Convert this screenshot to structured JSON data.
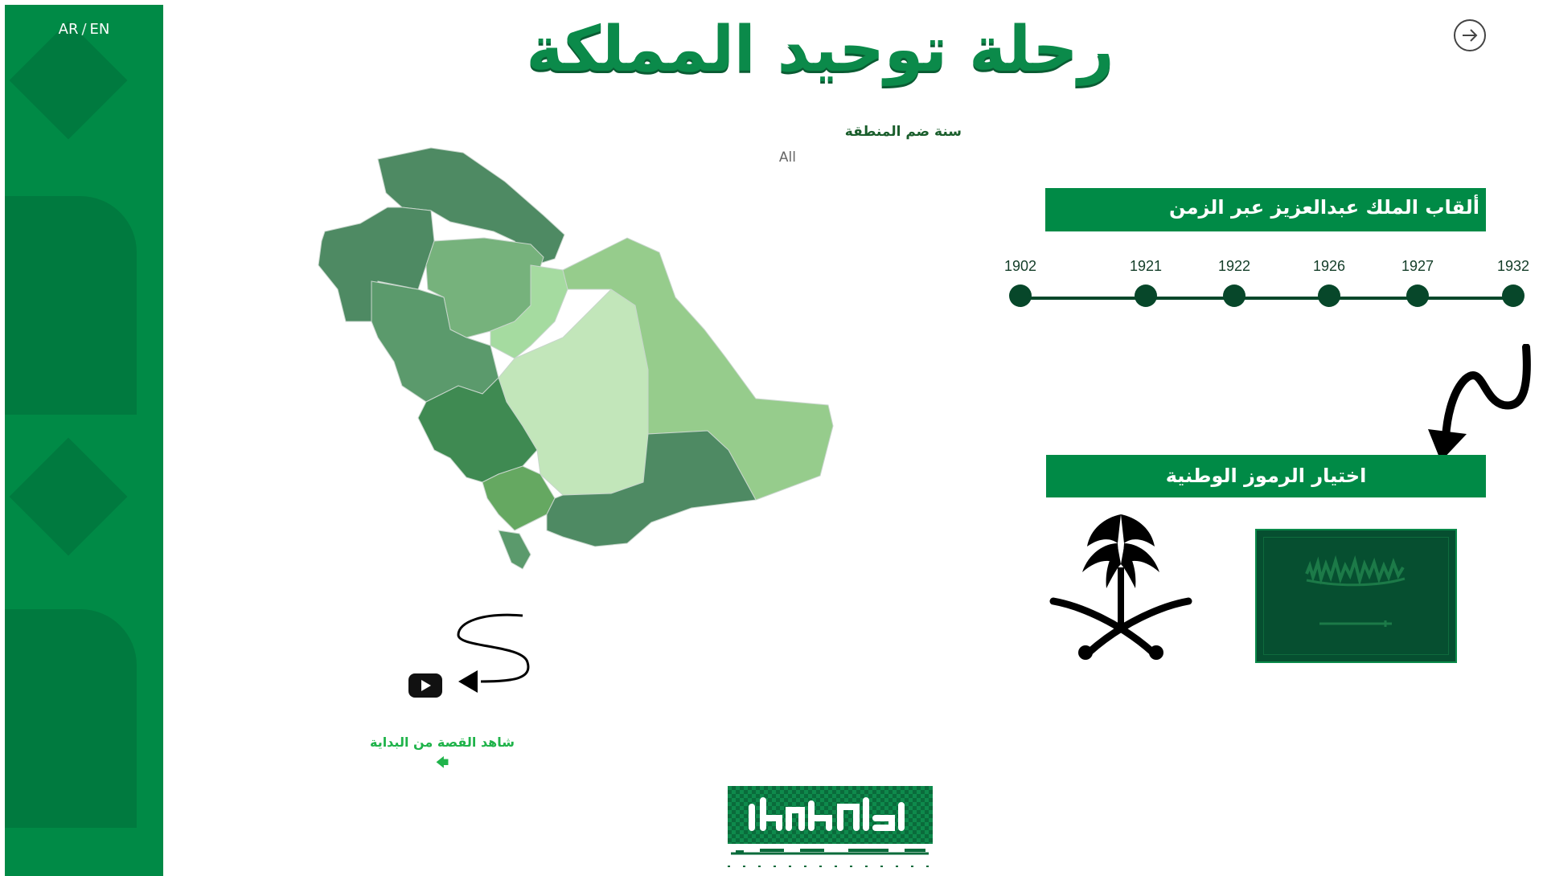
{
  "sidebar": {
    "lang_ar": "AR",
    "lang_separator": "/",
    "lang_en": "EN"
  },
  "header": {
    "title": "رحلة توحيد المملكة",
    "exit_icon": "arrow-right-circle-icon"
  },
  "filter": {
    "label": "سنة ضم المنطقة",
    "value": "All"
  },
  "map": {
    "region_colors": [
      "#4e8a63",
      "#5b9a6c",
      "#76b27c",
      "#a5dba0",
      "#c2e6ba",
      "#96cc8c",
      "#3f8a52",
      "#65a861"
    ]
  },
  "video": {
    "icon": "youtube-icon",
    "link_label": "شاهد القصة من البداية",
    "link_arrow": "🡄"
  },
  "titles_section": {
    "heading": "ألقاب الملك عبدالعزيز عبر الزمن",
    "years": [
      "1902",
      "1921",
      "1922",
      "1926",
      "1927",
      "1932"
    ]
  },
  "symbols_section": {
    "heading": "اختيار الرموز الوطنية",
    "emblem_icon": "palm-and-swords-emblem-icon",
    "flag_icon": "saudi-flag-icon"
  },
  "colors": {
    "brand_green": "#008a46",
    "dark_green": "#07472a",
    "link_green": "#1fb34a"
  }
}
